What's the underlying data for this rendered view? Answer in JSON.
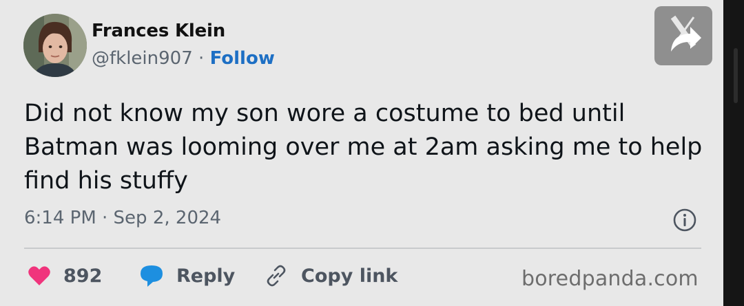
{
  "author": {
    "name": "Frances Klein",
    "handle": "@fklein907",
    "separator": " · ",
    "follow_label": "Follow"
  },
  "tweet": {
    "text": "Did not know my son wore a costume to bed until Batman was looming over me at 2am asking me to help find his stuffy",
    "timestamp": "6:14 PM · Sep 2, 2024"
  },
  "actions": {
    "like_count": "892",
    "reply_label": "Reply",
    "copy_label": "Copy link"
  },
  "watermark": "boredpanda.com",
  "icons": {
    "logo": "x-logo-icon",
    "share": "share-arrow-icon",
    "info": "info-icon",
    "like": "heart-icon",
    "reply": "speech-bubble-icon",
    "copy": "link-icon"
  },
  "colors": {
    "like": "#f0347c",
    "reply": "#1d8fe0",
    "follow": "#1d6fc4",
    "background": "#e8e8e8"
  }
}
